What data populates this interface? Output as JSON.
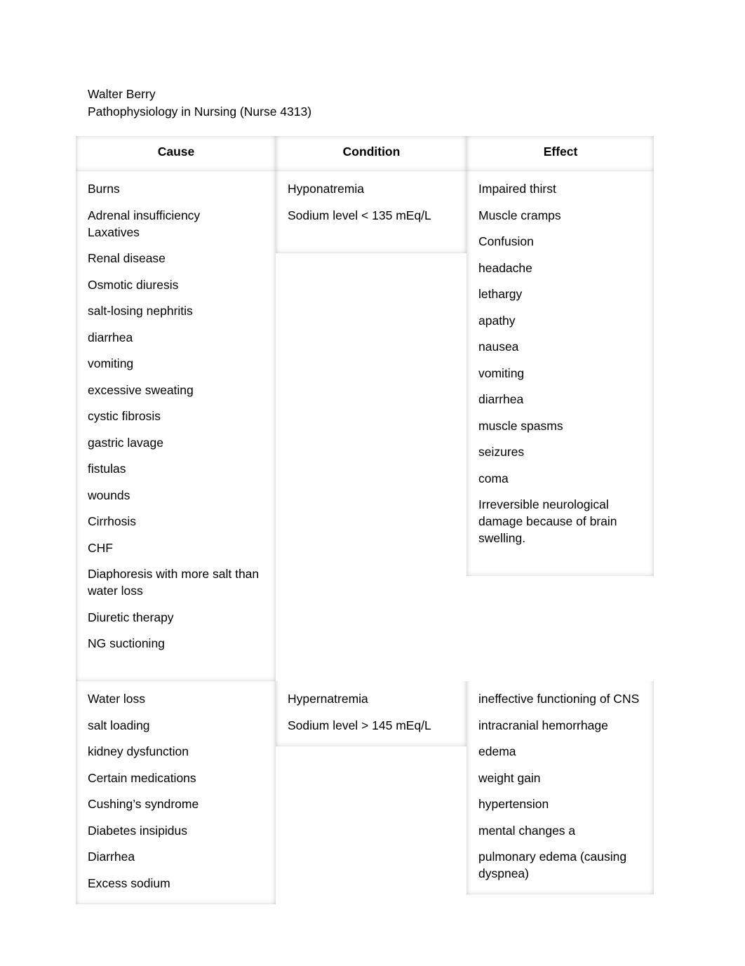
{
  "document": {
    "author": "Walter Berry",
    "course": "Pathophysiology in Nursing (Nurse 4313)"
  },
  "table": {
    "headers": {
      "cause": "Cause",
      "condition": "Condition",
      "effect": "Effect"
    },
    "rows": [
      {
        "cause": [
          "Burns",
          "Adrenal insufficiency\nLaxatives",
          "Renal disease",
          "Osmotic diuresis",
          "salt-losing nephritis",
          "diarrhea",
          "vomiting",
          "excessive sweating",
          "cystic fibrosis",
          "gastric lavage",
          "fistulas",
          "wounds",
          "Cirrhosis",
          "CHF",
          "Diaphoresis with more salt than water loss",
          "Diuretic therapy",
          "NG suctioning"
        ],
        "condition": [
          "Hyponatremia",
          "Sodium level < 135 mEq/L"
        ],
        "effect": [
          "Impaired thirst",
          "Muscle cramps",
          "Confusion",
          "headache",
          "lethargy",
          "apathy",
          "nausea",
          "vomiting",
          "diarrhea",
          "muscle spasms",
          "seizures",
          "coma",
          "Irreversible neurological damage because of brain swelling."
        ]
      },
      {
        "cause": [
          "Water loss",
          "salt loading",
          "kidney dysfunction",
          "Certain medications",
          "Cushing’s syndrome",
          "Diabetes insipidus",
          "Diarrhea",
          "Excess sodium"
        ],
        "condition": [
          "Hypernatremia",
          "Sodium level > 145 mEq/L"
        ],
        "effect": [
          "ineffective functioning of CNS",
          "intracranial hemorrhage",
          "edema",
          "weight gain",
          "hypertension",
          "mental changes a",
          "pulmonary edema (causing dyspnea)"
        ]
      }
    ]
  }
}
